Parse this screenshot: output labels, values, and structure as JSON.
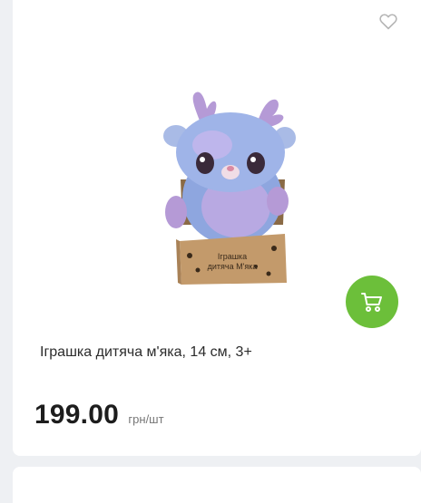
{
  "product": {
    "title": "Іграшка дитяча м'яка, 14 см, 3+",
    "price": "199.00",
    "unit": "грн/шт",
    "box_text_line1": "Іграшка",
    "box_text_line2": "дитяча М'яка"
  },
  "icons": {
    "favorite": "heart-outline-icon",
    "cart": "shopping-cart-icon"
  },
  "colors": {
    "accent": "#6cbf3a",
    "background": "#eef0f3",
    "card": "#ffffff"
  }
}
